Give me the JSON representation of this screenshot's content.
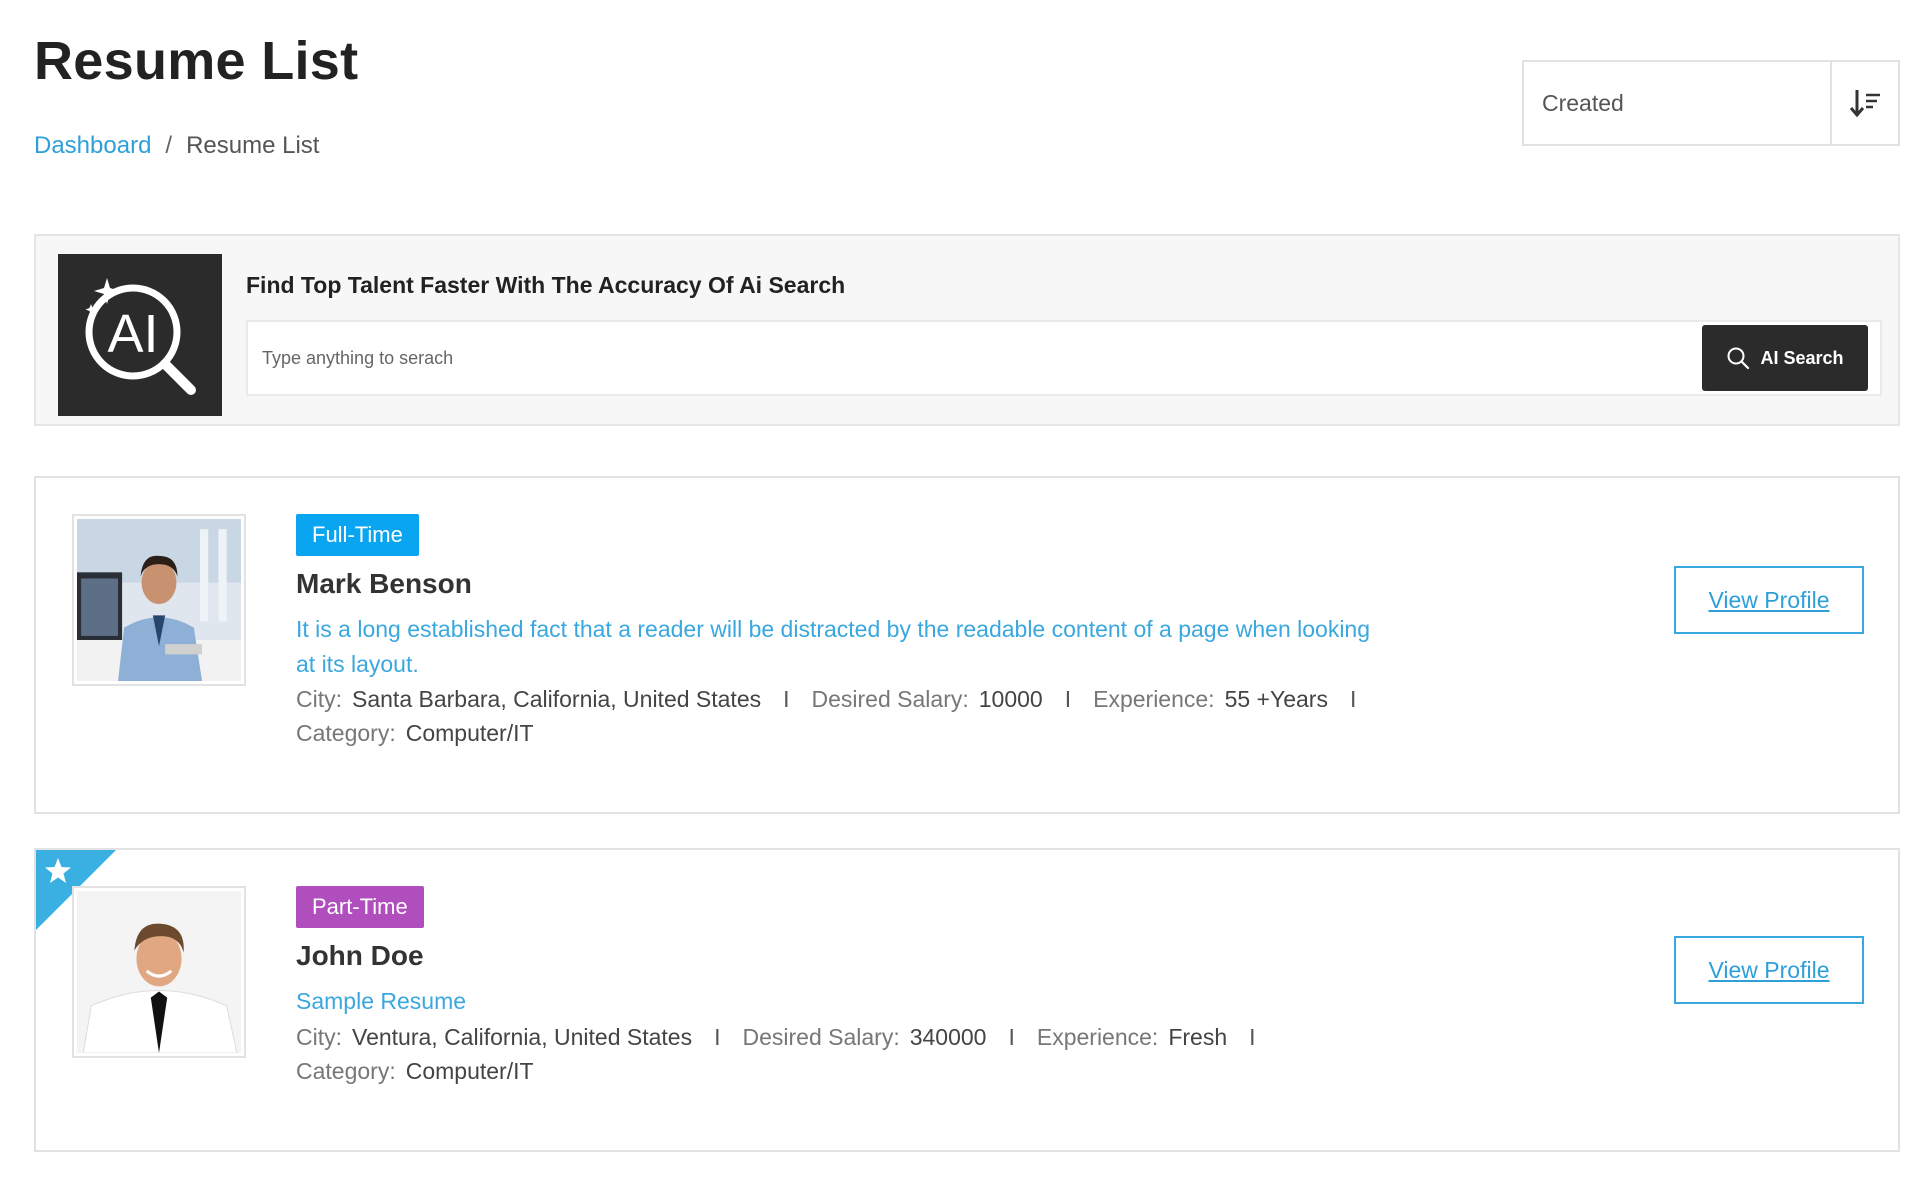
{
  "header": {
    "title": "Resume List"
  },
  "breadcrumb": {
    "items": [
      {
        "label": "Dashboard"
      },
      {
        "label": "Resume List"
      }
    ],
    "separator": "/"
  },
  "sort": {
    "selected": "Created",
    "toggle_icon": "sort-descending-icon"
  },
  "ai_search": {
    "logo_text": "AI",
    "heading": "Find Top Talent Faster With The Accuracy Of Ai Search",
    "placeholder": "Type anything to serach",
    "value": "",
    "button_label": "AI Search",
    "button_icon": "search-icon"
  },
  "resumes": [
    {
      "job_type": "Full-Time",
      "badge_color": "#0aa5f0",
      "name": "Mark Benson",
      "description": "It is a long established fact that a reader will be distracted by the readable content of a page when looking at its layout.",
      "city_label": "City:",
      "city": "Santa Barbara, California, United States",
      "salary_label": "Desired Salary:",
      "salary": "10000",
      "experience_label": "Experience:",
      "experience": "55 +Years",
      "category_label": "Category:",
      "category": "Computer/IT",
      "separator": "I",
      "view_label": "View Profile",
      "featured": false
    },
    {
      "job_type": "Part-Time",
      "badge_color": "#b04ebd",
      "name": "John Doe",
      "description": "Sample Resume",
      "city_label": "City:",
      "city": "Ventura, California, United States",
      "salary_label": "Desired Salary:",
      "salary": "340000",
      "experience_label": "Experience:",
      "experience": "Fresh",
      "category_label": "Category:",
      "category": "Computer/IT",
      "separator": "I",
      "view_label": "View Profile",
      "featured": true
    }
  ],
  "colors": {
    "accent": "#2f9fd9",
    "dark": "#2b2b2b",
    "ribbon": "#3ab0e2"
  }
}
